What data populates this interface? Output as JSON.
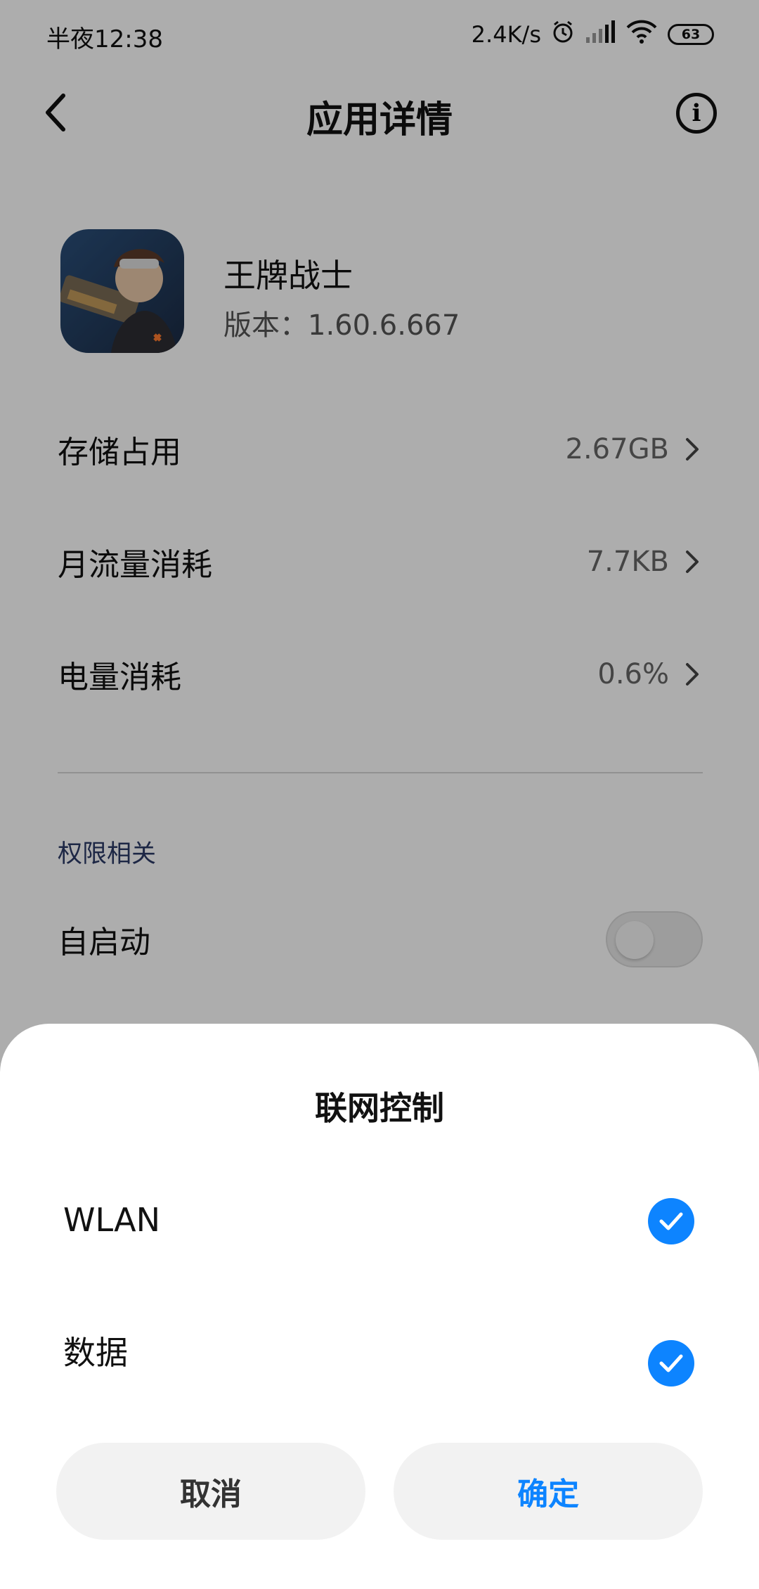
{
  "status_bar": {
    "time": "半夜12:38",
    "network_speed": "2.4K/s",
    "battery": "63",
    "icons": [
      "alarm-icon",
      "signal-icon",
      "wifi-icon",
      "battery-icon"
    ]
  },
  "header": {
    "title": "应用详情",
    "back_icon": "chevron-left-icon",
    "info_icon": "info-icon"
  },
  "app": {
    "name": "王牌战士",
    "version": "版本：1.60.6.667"
  },
  "rows": [
    {
      "label": "存储占用",
      "value": "2.67GB"
    },
    {
      "label": "月流量消耗",
      "value": "7.7KB"
    },
    {
      "label": "电量消耗",
      "value": "0.6%"
    }
  ],
  "permissions": {
    "section_title": "权限相关",
    "autostart_label": "自启动",
    "autostart_on": false
  },
  "sheet": {
    "title": "联网控制",
    "options": [
      {
        "label": "WLAN",
        "checked": true
      },
      {
        "label": "数据",
        "checked": true
      }
    ],
    "cancel_label": "取消",
    "ok_label": "确定"
  },
  "colors": {
    "accent": "#0d84ff",
    "overlay": "rgba(0,0,0,0.32)"
  }
}
